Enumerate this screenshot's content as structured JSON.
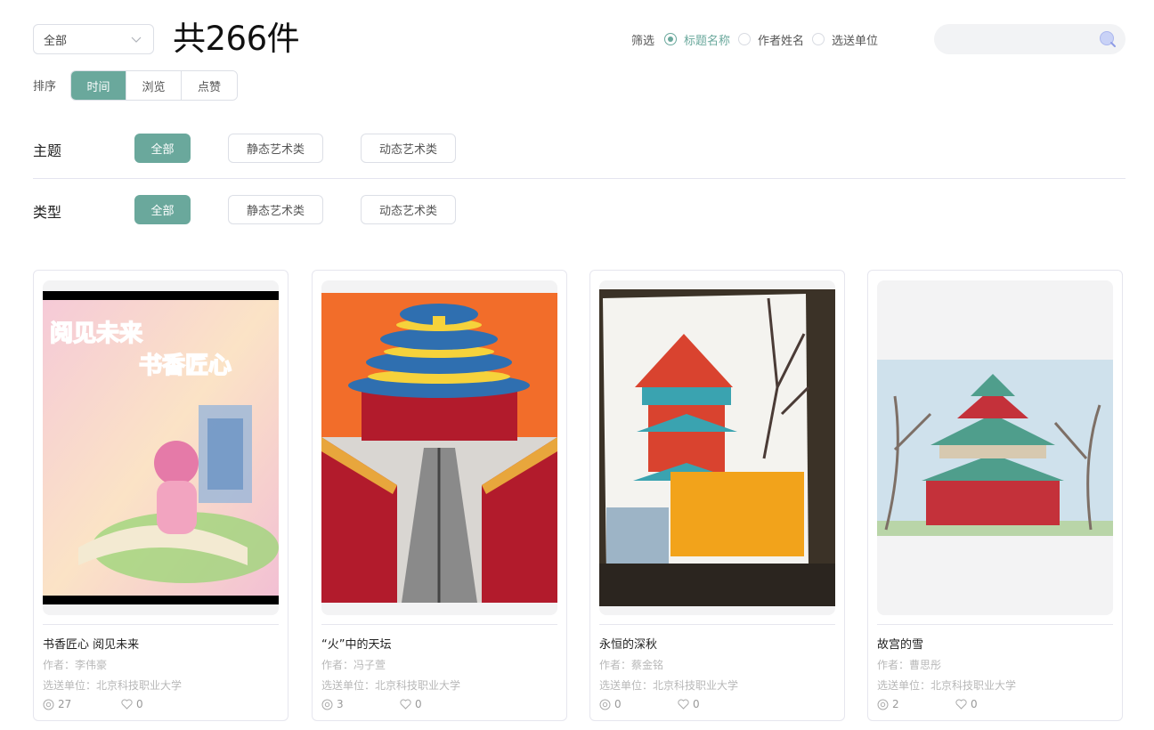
{
  "header": {
    "category_select": "全部",
    "total_count": "共266件",
    "filter_label": "筛选",
    "filter_options": [
      "标题名称",
      "作者姓名",
      "选送单位"
    ],
    "search_placeholder": ""
  },
  "sort": {
    "label": "排序",
    "tabs": [
      "时间",
      "浏览",
      "点赞"
    ]
  },
  "facets": {
    "theme": {
      "label": "主题",
      "options": [
        "全部",
        "静态艺术类",
        "动态艺术类"
      ]
    },
    "type": {
      "label": "类型",
      "options": [
        "全部",
        "静态艺术类",
        "动态艺术类"
      ]
    }
  },
  "cards": [
    {
      "title": "书香匠心 阅见未来",
      "author": "作者：李伟豪",
      "unit": "选送单位：北京科技职业大学",
      "views": "27",
      "likes": "0",
      "image_text": [
        "阅见未来",
        "书香匠心"
      ]
    },
    {
      "title": "“火”中的天坛",
      "author": "作者：冯子萱",
      "unit": "选送单位：北京科技职业大学",
      "views": "3",
      "likes": "0"
    },
    {
      "title": "永恒的深秋",
      "author": "作者：蔡金铭",
      "unit": "选送单位：北京科技职业大学",
      "views": "0",
      "likes": "0"
    },
    {
      "title": "故宫的雪",
      "author": "作者：曹思彤",
      "unit": "选送单位：北京科技职业大学",
      "views": "2",
      "likes": "0"
    }
  ],
  "colors": {
    "accent": "#6aa89c",
    "border": "#dcdfe6",
    "muted": "#b8b8b8"
  }
}
